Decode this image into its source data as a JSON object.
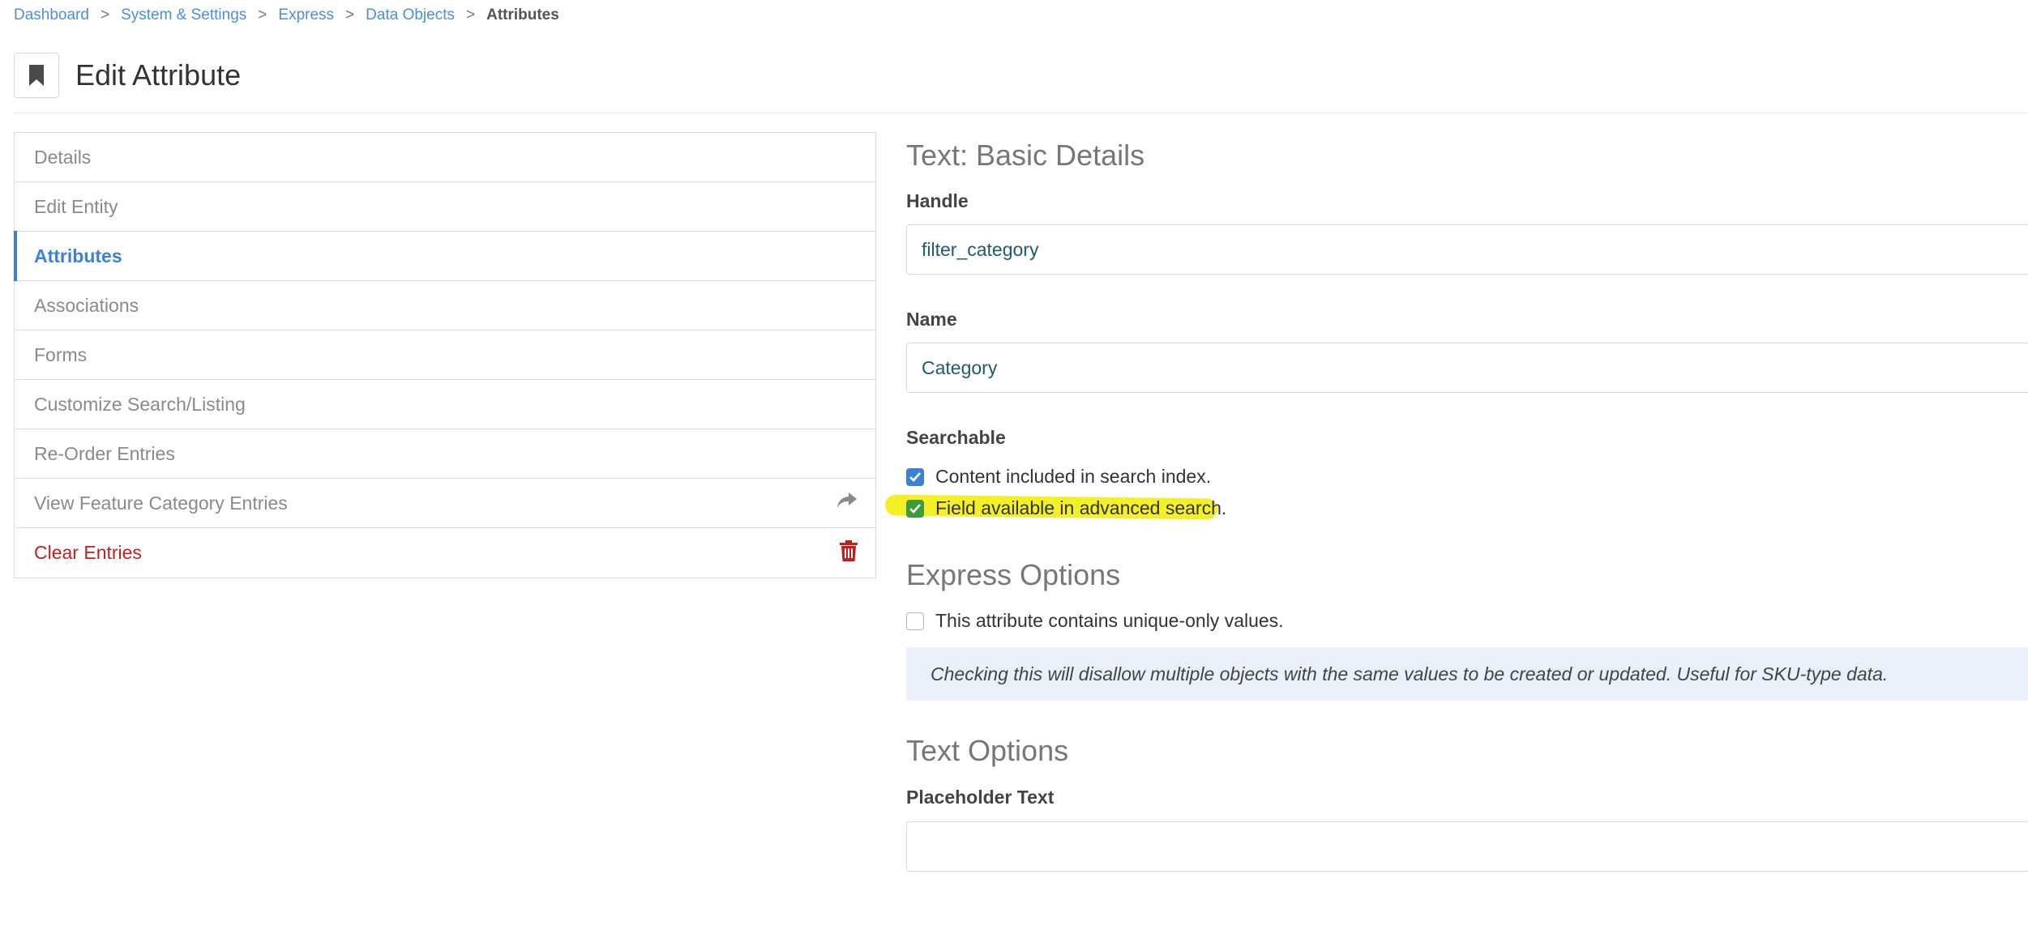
{
  "breadcrumb": {
    "items": [
      "Dashboard",
      "System & Settings",
      "Express",
      "Data Objects"
    ],
    "separator": ">",
    "current": "Attributes"
  },
  "header": {
    "title": "Edit Attribute",
    "icon": "bookmark-icon"
  },
  "sidebar": {
    "items": [
      {
        "label": "Details"
      },
      {
        "label": "Edit Entity"
      },
      {
        "label": "Attributes",
        "active": true
      },
      {
        "label": "Associations"
      },
      {
        "label": "Forms"
      },
      {
        "label": "Customize Search/Listing"
      },
      {
        "label": "Re-Order Entries"
      },
      {
        "label": "View Feature Category Entries",
        "icon": "share-arrow-icon"
      },
      {
        "label": "Clear Entries",
        "icon": "trash-icon",
        "color": "#c41e1e"
      }
    ]
  },
  "main": {
    "basic_details_title": "Text: Basic Details",
    "handle": {
      "label": "Handle",
      "value": "filter_category"
    },
    "name": {
      "label": "Name",
      "value": "Category"
    },
    "searchable": {
      "label": "Searchable",
      "options": [
        {
          "label": "Content included in search index.",
          "checked": true
        },
        {
          "label": "Field available in advanced search.",
          "checked": true,
          "highlighted": true
        }
      ]
    },
    "express_options": {
      "title": "Express Options",
      "unique": {
        "label": "This attribute contains unique-only values.",
        "checked": false
      },
      "help": "Checking this will disallow multiple objects with the same values to be created or updated. Useful for SKU-type data."
    },
    "text_options": {
      "title": "Text Options",
      "placeholder": {
        "label": "Placeholder Text",
        "value": ""
      }
    }
  },
  "colors": {
    "link": "#4a90d9",
    "active": "#3b82d6",
    "danger": "#c41e1e",
    "highlight": "#f3f028",
    "help_bg": "#e8f1fa"
  }
}
